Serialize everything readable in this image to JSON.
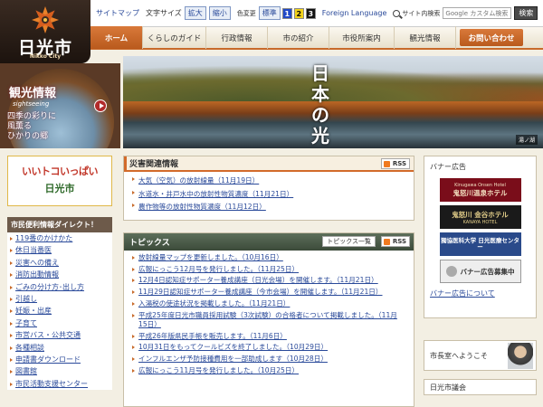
{
  "logo": {
    "city_jp": "日光市",
    "city_en": "Nikko City"
  },
  "utility": {
    "sitemap": "サイトマップ",
    "text_size_label": "文字サイズ",
    "enlarge": "拡大",
    "shrink": "縮小",
    "color_change_label": "色変更",
    "standard": "標準",
    "colors": [
      "1",
      "2",
      "3"
    ],
    "color_swatches": [
      "#2048c8",
      "#f2d21a",
      "#111111"
    ],
    "foreign_language": "Foreign Language",
    "site_search_label": "サイト内検索",
    "search_placeholder": "Google カスタム検索",
    "search_button": "検索"
  },
  "nav": {
    "items": [
      "ホーム",
      "くらしのガイド",
      "行政情報",
      "市の紹介",
      "市役所案内",
      "観光情報"
    ],
    "contact": "お問い合わせ"
  },
  "tourism_banner": {
    "title": "観光情報",
    "subtitle": "sightseeing",
    "line1": "四季の彩りに",
    "line2": "風薫る",
    "line3": "ひかりの郷"
  },
  "hero": {
    "title": "日本の光",
    "caption": "湯ノ湖"
  },
  "pr_banner": {
    "line1": "いいトコいっぱい",
    "line2": "日光市"
  },
  "directory": {
    "title": "市民便利情報ダイレクト！",
    "items": [
      "119番のかけかた",
      "休日当番医",
      "災害への備え",
      "消防出動情報",
      "ごみの分け方･出し方",
      "引越し",
      "妊娠・出産",
      "子育て",
      "市営バス・公共交通",
      "各種相談",
      "申請書ダウンロード",
      "図書館",
      "市民活動支援センター"
    ]
  },
  "disaster": {
    "title": "災害関連情報",
    "rss": "RSS",
    "items": [
      "大気（空気）の放射線量（11月19日）",
      "水道水・井戸水中の放射性物質濃度（11月21日）",
      "農作物等の放射性物質濃度（11月12日）"
    ]
  },
  "topics": {
    "title": "トピックス",
    "list_button": "トピックス一覧",
    "rss": "RSS",
    "items": [
      "放射線量マップを更新しました。（10月16日）",
      "広報にっこう12月号を発行しました。（11月25日）",
      "12月4日認知症サポーター養成講座（日光会場）を開催します。（11月21日）",
      "11月29日認知症サポーター養成講座（今市会場）を開催します。（11月21日）",
      "入湯税の使途状況を掲載しました。（11月21日）",
      "平成25年度日光市職員採用試験（3次試験）の合格者について掲載しました。（11月15日）",
      "平成26年版県民手帳を販売します。（11月6日）",
      "10月31日をもってクールビズを終了しました。（10月29日）",
      "インフルエンザ予防接種費用を一部助成します（10月28日）",
      "広報にっこう11月号を発行しました。（10月25日）"
    ]
  },
  "banner_ads": {
    "title": "バナー広告",
    "ads": [
      {
        "sub": "Kinugawa Onsen Hotel",
        "name": "鬼怒川温泉ホテル"
      },
      {
        "sub": "KANAYA HOTEL",
        "name": "鬼怒川 金谷ホテル"
      },
      {
        "name": "獨協医科大学 日光医療センター"
      },
      {
        "name": "バナー広告募集中"
      }
    ],
    "about": "バナー広告について"
  },
  "mayor": "市長室へようこそ",
  "assembly": "日光市議会"
}
